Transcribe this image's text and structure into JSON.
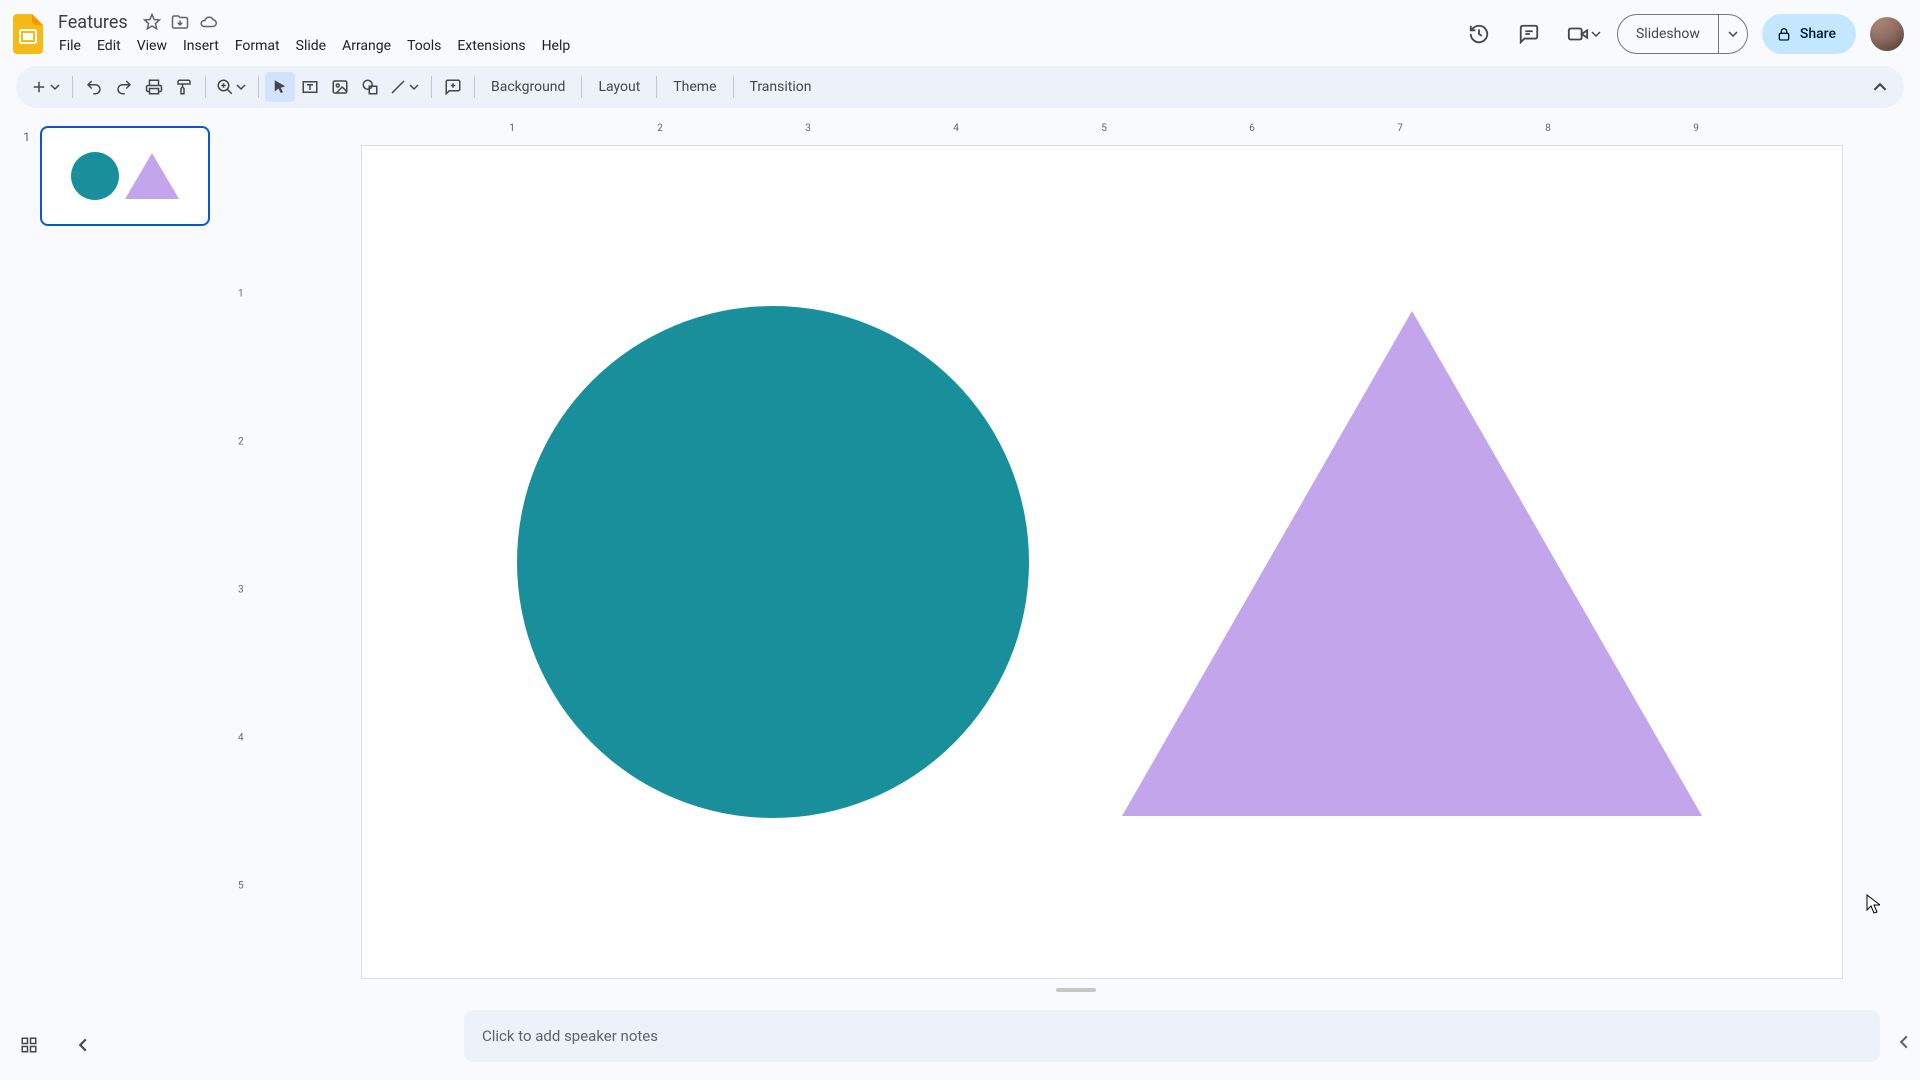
{
  "doc": {
    "title": "Features"
  },
  "menus": {
    "file": "File",
    "edit": "Edit",
    "view": "View",
    "insert": "Insert",
    "format": "Format",
    "slide": "Slide",
    "arrange": "Arrange",
    "tools": "Tools",
    "extensions": "Extensions",
    "help": "Help"
  },
  "header": {
    "slideshow": "Slideshow",
    "share": "Share"
  },
  "toolbar": {
    "background": "Background",
    "layout": "Layout",
    "theme": "Theme",
    "transition": "Transition"
  },
  "filmstrip": {
    "slide1_num": "1"
  },
  "notes": {
    "placeholder": "Click to add speaker notes"
  },
  "ruler_h": [
    "1",
    "2",
    "3",
    "4",
    "5",
    "6",
    "7",
    "8",
    "9"
  ],
  "ruler_v": [
    "1",
    "2",
    "3",
    "4",
    "5"
  ],
  "shapes": {
    "circle_color": "#1a8f9c",
    "triangle_color": "#c2a5ea"
  }
}
